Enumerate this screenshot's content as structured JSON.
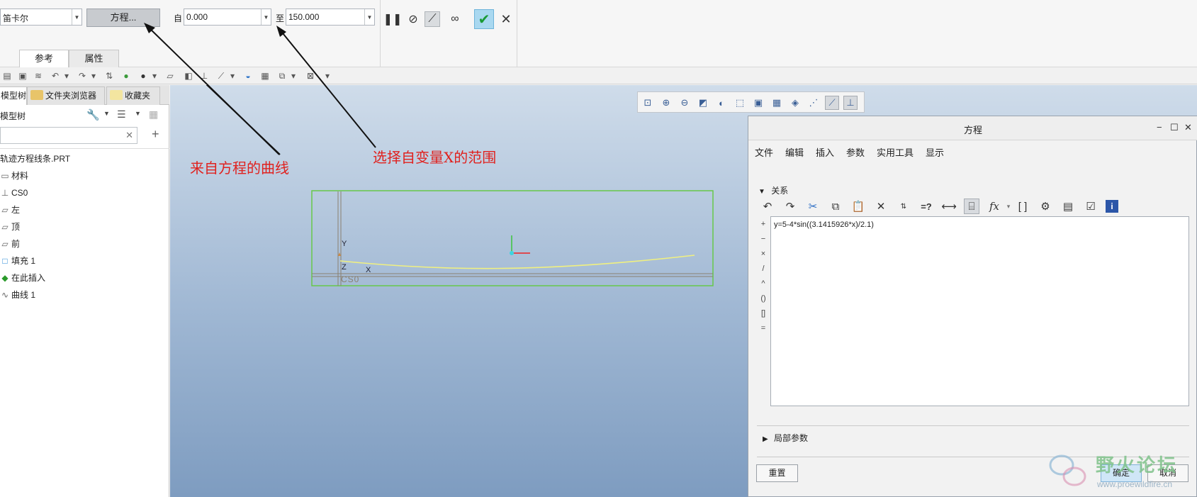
{
  "ribbon": {
    "coord_type": "笛卡尔",
    "equation_button": "方程...",
    "from_label": "自",
    "from_value": "0.000",
    "to_label": "至",
    "to_value": "150.000",
    "tabs": [
      "参考",
      "属性"
    ]
  },
  "left_panel": {
    "tabs": [
      "模型树",
      "文件夹浏览器",
      "收藏夹"
    ],
    "tree_title": "模型树",
    "items": [
      {
        "label": "轨迹方程线条.PRT",
        "icon": ""
      },
      {
        "label": "材料",
        "icon": "▭"
      },
      {
        "label": "CS0",
        "icon": "⊥"
      },
      {
        "label": "左",
        "icon": "▱"
      },
      {
        "label": "顶",
        "icon": "▱"
      },
      {
        "label": "前",
        "icon": "▱"
      },
      {
        "label": "填充 1",
        "icon": "□"
      },
      {
        "label": "在此插入",
        "icon": "◆"
      },
      {
        "label": "曲线 1",
        "icon": "∿"
      }
    ]
  },
  "annotations": {
    "curve_from_equation": "来自方程的曲线",
    "select_x_range": "选择自变量X的范围"
  },
  "viewport": {
    "axis_y": "Y",
    "axis_z": "Z",
    "axis_x": "X",
    "csys_label": "CS0"
  },
  "dialog": {
    "title": "方程",
    "menu": [
      "文件",
      "编辑",
      "插入",
      "参数",
      "实用工具",
      "显示"
    ],
    "relations_header": "关系",
    "operators": [
      "+",
      "−",
      "×",
      "/",
      "^",
      "()",
      "[]",
      "="
    ],
    "equation": "y=5-4*sin((3.1415926*x)/2.1)",
    "local_params_header": "局部参数",
    "reset_button": "重置",
    "ok_button": "确定",
    "cancel_button": "取消"
  },
  "watermark": {
    "name": "野火论坛",
    "url": "www.proewildfire.cn"
  },
  "colors": {
    "annotation_red": "#e0211e",
    "ok_check_green": "#1a9a36",
    "curve_yellow": "#f0f080",
    "feature_outline_green": "#67c84a"
  }
}
